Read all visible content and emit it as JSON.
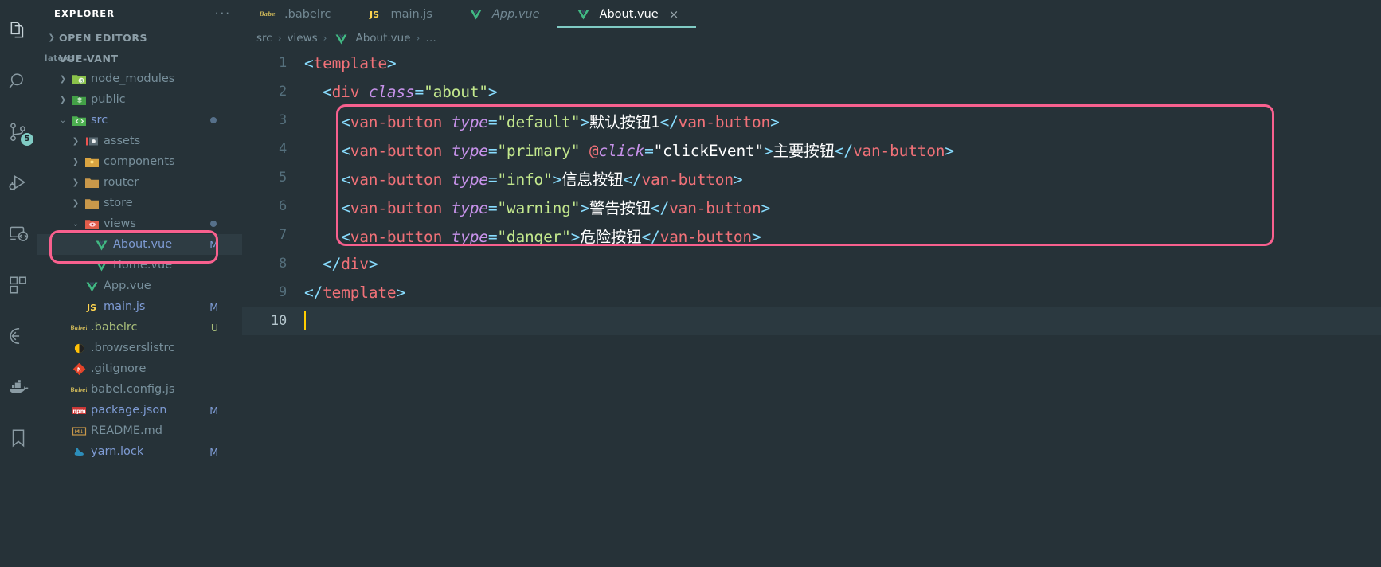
{
  "window": {
    "theme_bg": "#263238",
    "accent": "#80cbc4",
    "highlight_ring": "#f8608e"
  },
  "activitybar": {
    "items": [
      {
        "name": "explorer-icon",
        "badge": ""
      },
      {
        "name": "search-icon",
        "badge": ""
      },
      {
        "name": "source-control-icon",
        "badge": "5"
      },
      {
        "name": "run-and-debug-icon",
        "badge": ""
      },
      {
        "name": "remote-explorer-icon",
        "badge": ""
      },
      {
        "name": "extensions-icon",
        "badge": ""
      },
      {
        "name": "eslint-icon",
        "badge": ""
      },
      {
        "name": "docker-icon",
        "badge": ""
      },
      {
        "name": "bookmarks-icon",
        "badge": ""
      }
    ]
  },
  "sidebar": {
    "title": "EXPLORER",
    "more_actions": "···",
    "sections": [
      {
        "label": "OPEN EDITORS",
        "expanded": false
      },
      {
        "label": "VUE-VANT",
        "expanded": true
      }
    ],
    "tree": [
      {
        "label": "node_modules",
        "indent": 2,
        "chevron": "›",
        "icon": "folder-node-modules",
        "color": "dim",
        "badge": ""
      },
      {
        "label": "public",
        "indent": 2,
        "chevron": "›",
        "icon": "folder-public",
        "color": "dim",
        "badge": ""
      },
      {
        "label": "src",
        "indent": 2,
        "chevron": "⌄",
        "icon": "folder-src",
        "color": "mod",
        "badge": "dot"
      },
      {
        "label": "assets",
        "indent": 3,
        "chevron": "›",
        "icon": "folder-assets",
        "color": "dim",
        "badge": ""
      },
      {
        "label": "components",
        "indent": 3,
        "chevron": "›",
        "icon": "folder-components",
        "color": "dim",
        "badge": ""
      },
      {
        "label": "router",
        "indent": 3,
        "chevron": "›",
        "icon": "folder-router",
        "color": "dim",
        "badge": ""
      },
      {
        "label": "store",
        "indent": 3,
        "chevron": "›",
        "icon": "folder-store",
        "color": "dim",
        "badge": ""
      },
      {
        "label": "views",
        "indent": 3,
        "chevron": "⌄",
        "icon": "folder-views",
        "color": "dim",
        "badge": "dot"
      },
      {
        "label": "About.vue",
        "indent": 4,
        "chevron": "",
        "icon": "vue-file",
        "color": "mod",
        "badge": "M",
        "selected": true
      },
      {
        "label": "Home.vue",
        "indent": 4,
        "chevron": "",
        "icon": "vue-file",
        "color": "dim",
        "badge": ""
      },
      {
        "label": "App.vue",
        "indent": 3,
        "chevron": "",
        "icon": "vue-file",
        "color": "dim",
        "badge": ""
      },
      {
        "label": "main.js",
        "indent": 3,
        "chevron": "",
        "icon": "js-file",
        "color": "mod",
        "badge": "M"
      },
      {
        "label": ".babelrc",
        "indent": 2,
        "chevron": "",
        "icon": "babel-file",
        "color": "green",
        "badge": "U"
      },
      {
        "label": ".browserslistrc",
        "indent": 2,
        "chevron": "",
        "icon": "browserslist-file",
        "color": "dim",
        "badge": ""
      },
      {
        "label": ".gitignore",
        "indent": 2,
        "chevron": "",
        "icon": "git-file",
        "color": "dim",
        "badge": ""
      },
      {
        "label": "babel.config.js",
        "indent": 2,
        "chevron": "",
        "icon": "babel-file",
        "color": "dim",
        "badge": ""
      },
      {
        "label": "package.json",
        "indent": 2,
        "chevron": "",
        "icon": "npm-file",
        "color": "mod",
        "badge": "M"
      },
      {
        "label": "README.md",
        "indent": 2,
        "chevron": "",
        "icon": "markdown-file",
        "color": "dim",
        "badge": ""
      },
      {
        "label": "yarn.lock",
        "indent": 2,
        "chevron": "",
        "icon": "yarn-file",
        "color": "mod",
        "badge": "M"
      }
    ]
  },
  "tabs": [
    {
      "label": ".babelrc",
      "icon": "babel-file",
      "active": false,
      "italic": false,
      "close": false
    },
    {
      "label": "main.js",
      "icon": "js-file",
      "active": false,
      "italic": false,
      "close": false
    },
    {
      "label": "App.vue",
      "icon": "vue-file",
      "active": false,
      "italic": true,
      "close": false
    },
    {
      "label": "About.vue",
      "icon": "vue-file",
      "active": true,
      "italic": false,
      "close": true,
      "close_label": "×"
    }
  ],
  "breadcrumb": {
    "items": [
      "src",
      "views",
      "About.vue",
      "…"
    ],
    "separator": "›"
  },
  "code": {
    "language": "vue",
    "lines": [
      {
        "num": "1",
        "text": "<template>"
      },
      {
        "num": "2",
        "text": "  <div class=\"about\">"
      },
      {
        "num": "3",
        "text": "    <van-button type=\"default\">默认按钮1</van-button>"
      },
      {
        "num": "4",
        "text": "    <van-button type=\"primary\" @click=\"clickEvent\">主要按钮</van-button>"
      },
      {
        "num": "5",
        "text": "    <van-button type=\"info\">信息按钮</van-button>"
      },
      {
        "num": "6",
        "text": "    <van-button type=\"warning\">警告按钮</van-button>"
      },
      {
        "num": "7",
        "text": "    <van-button type=\"danger\">危险按钮</van-button>"
      },
      {
        "num": "8",
        "text": "  </div>"
      },
      {
        "num": "9",
        "text": "</template>"
      },
      {
        "num": "10",
        "text": ""
      }
    ],
    "cursor_line": "10"
  },
  "annotations": [
    {
      "name": "code-block-highlight",
      "target": "van-button lines 3-7"
    },
    {
      "name": "file-highlight",
      "target": "About.vue in explorer"
    }
  ]
}
